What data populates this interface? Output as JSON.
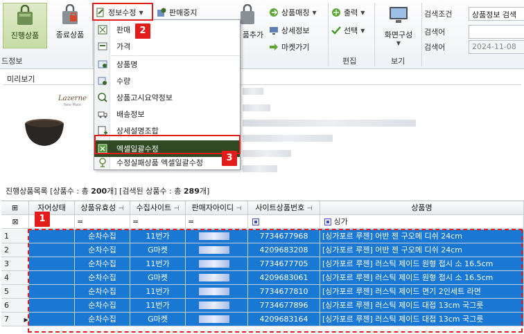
{
  "ribbon": {
    "btn_active": "진행상품",
    "btn_ended": "종료상품",
    "group_partial": "드정보",
    "info_edit": "정보수정",
    "stop_sale": "판매중지",
    "add_partial": "품추가",
    "product_matching": "상품매칭",
    "detail_info": "상세정보",
    "go_market": "마켓가기",
    "print": "출력",
    "select": "선택",
    "edit_group": "편집",
    "screen_config": "화면구성",
    "view_group": "보기"
  },
  "search": {
    "condition_label": "검색조건",
    "condition_value": "상품정보 검색",
    "keyword1_label": "검색어",
    "keyword2_label": "검색어",
    "date_value": "2024-11-08"
  },
  "preview": {
    "title": "미리보기",
    "logo": "Lazerne",
    "logo_sub": "New Mate"
  },
  "dropdown": {
    "items": [
      "판매",
      "가격",
      "상품명",
      "수량",
      "상품고시요약정보",
      "배송정보",
      "상세설명조합",
      "엑셀일괄수정",
      "수정실패상품 엑셀일괄수정"
    ]
  },
  "summary": {
    "prefix": "진행상품목록  [상품수 : 총 ",
    "total": "200",
    "mid": "개] [검색된 상품수 : 총 ",
    "found": "289",
    "suffix": "개]"
  },
  "grid": {
    "headers": [
      "자어상태",
      "상품유효성",
      "수집사이트",
      "판매자아이디",
      "사이트상품번호",
      "상품명"
    ],
    "filter_eq": "=",
    "filter_name": "싱가",
    "rows": [
      {
        "n": "1",
        "validity": "순차수집",
        "site": "11번가",
        "code": "7734677968",
        "name": "[싱가포르 루젠] 어반 젠 구오메 디쉬 24cm"
      },
      {
        "n": "2",
        "validity": "순차수집",
        "site": "G마켓",
        "code": "4209683208",
        "name": "[싱가포르 루젠] 어반 젠 구오메 디쉬 24cm"
      },
      {
        "n": "3",
        "validity": "순차수집",
        "site": "11번가",
        "code": "7734677705",
        "name": "[싱가포르 루젠] 러스틱 제이드 원형 접시 소 16.5cm"
      },
      {
        "n": "4",
        "validity": "순차수집",
        "site": "G마켓",
        "code": "4209683061",
        "name": "[싱가포르 루젠] 러스틱 제이드 원형 접시 소 16.5cm"
      },
      {
        "n": "5",
        "validity": "순차수집",
        "site": "11번가",
        "code": "7734677810",
        "name": "[싱가포르 루젠] 러스틱 제이드 면기 2인세트 라면"
      },
      {
        "n": "6",
        "validity": "순차수집",
        "site": "11번가",
        "code": "7734677896",
        "name": "[싱가포르 루젠] 러스틱 제이드 대접 13cm 국그릇"
      },
      {
        "n": "7",
        "validity": "순차수집",
        "site": "G마켓",
        "code": "4209683164",
        "name": "[싱가포르 루젠] 러스틱 제이드 대접 13cm 국그릇"
      }
    ]
  },
  "badges": {
    "one": "1",
    "two": "2",
    "three": "3"
  },
  "colors": {
    "selection": "#1978d4",
    "highlight": "#2f4a23",
    "callout": "#e21b1b"
  }
}
